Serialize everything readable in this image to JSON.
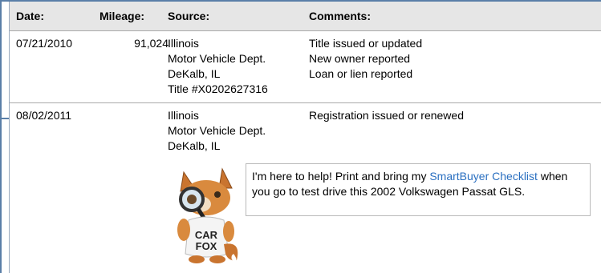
{
  "table": {
    "headers": {
      "date": "Date:",
      "mileage": "Mileage:",
      "source": "Source:",
      "comments": "Comments:"
    },
    "rows": [
      {
        "date": "07/21/2010",
        "mileage": "91,024",
        "source": [
          "Illinois",
          "Motor Vehicle Dept.",
          "DeKalb, IL",
          "Title #X0202627316"
        ],
        "comments": [
          "Title issued or updated",
          "New owner reported",
          "Loan or lien reported"
        ]
      },
      {
        "date": "08/02/2011",
        "mileage": "",
        "source": [
          "Illinois",
          "Motor Vehicle Dept.",
          "DeKalb, IL"
        ],
        "comments": [
          "Registration issued or renewed"
        ]
      }
    ]
  },
  "mascot": {
    "shirt_text_line1": "CAR",
    "shirt_text_line2": "FOX",
    "icon": "carfox-mascot-icon"
  },
  "bubble": {
    "prefix": "I'm here to help! Print and bring my ",
    "link": "SmartBuyer Checklist",
    "suffix": " when you go to test drive this 2002 Volkswagen Passat GLS."
  },
  "colors": {
    "link": "#2a6fc0",
    "header_bg": "#e6e6e6",
    "frame": "#5a7fa8"
  }
}
